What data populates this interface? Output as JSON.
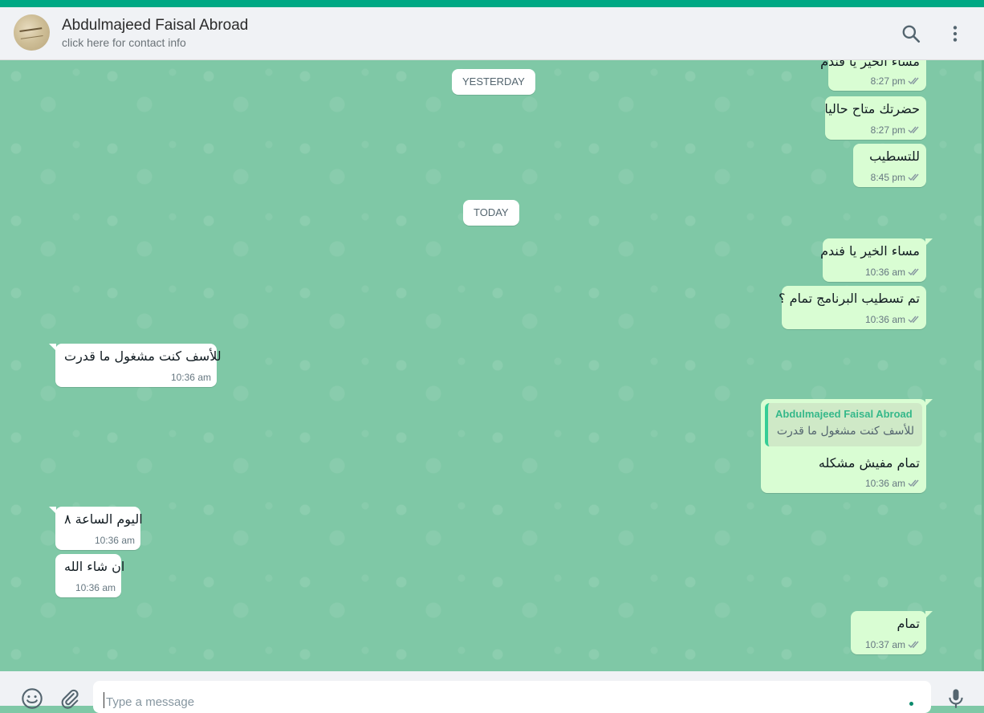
{
  "header": {
    "contact_name": "Abdulmajeed Faisal Abroad",
    "contact_sub": "click here for contact info",
    "icons": [
      "search-icon",
      "menu-icon"
    ]
  },
  "dates": {
    "yesterday": "YESTERDAY",
    "today": "TODAY"
  },
  "messages": [
    {
      "dir": "out",
      "text": "مساء الخير يا فندم",
      "time": "8:27 pm",
      "ticks": "read"
    },
    {
      "dir": "out",
      "text": "حضرتك متاح حاليا",
      "time": "8:27 pm",
      "ticks": "read"
    },
    {
      "dir": "out",
      "text": "للتسطيب",
      "time": "8:45 pm",
      "ticks": "read"
    },
    {
      "dir": "out",
      "text": "مساء الخير يا فندم",
      "time": "10:36 am",
      "ticks": "read"
    },
    {
      "dir": "out",
      "text": "تم تسطيب البرنامج تمام ؟",
      "time": "10:36 am",
      "ticks": "read"
    },
    {
      "dir": "in",
      "text": "للأسف كنت مشغول ما قدرت",
      "time": "10:36 am"
    },
    {
      "dir": "out",
      "quote_name": "Abdulmajeed Faisal Abroad",
      "quote_text": "للأسف كنت مشغول ما قدرت",
      "text": "تمام مفيش مشكله",
      "time": "10:36 am",
      "ticks": "read"
    },
    {
      "dir": "in",
      "text": "اليوم الساعة ٨",
      "time": "10:36 am"
    },
    {
      "dir": "in",
      "text": "ان شاء الله",
      "time": "10:36 am"
    },
    {
      "dir": "out",
      "text": "تمام",
      "time": "10:37 am",
      "ticks": "read"
    }
  ],
  "footer": {
    "placeholder": "Type a message",
    "icons": [
      "emoji-icon",
      "attach-icon",
      "mic-icon"
    ]
  },
  "colors": {
    "accent": "#00a884",
    "outgoing_bubble": "#d9fdd3",
    "incoming_bubble": "#ffffff",
    "chat_background": "#7fc8a6",
    "tick_color": "#8696a0"
  }
}
